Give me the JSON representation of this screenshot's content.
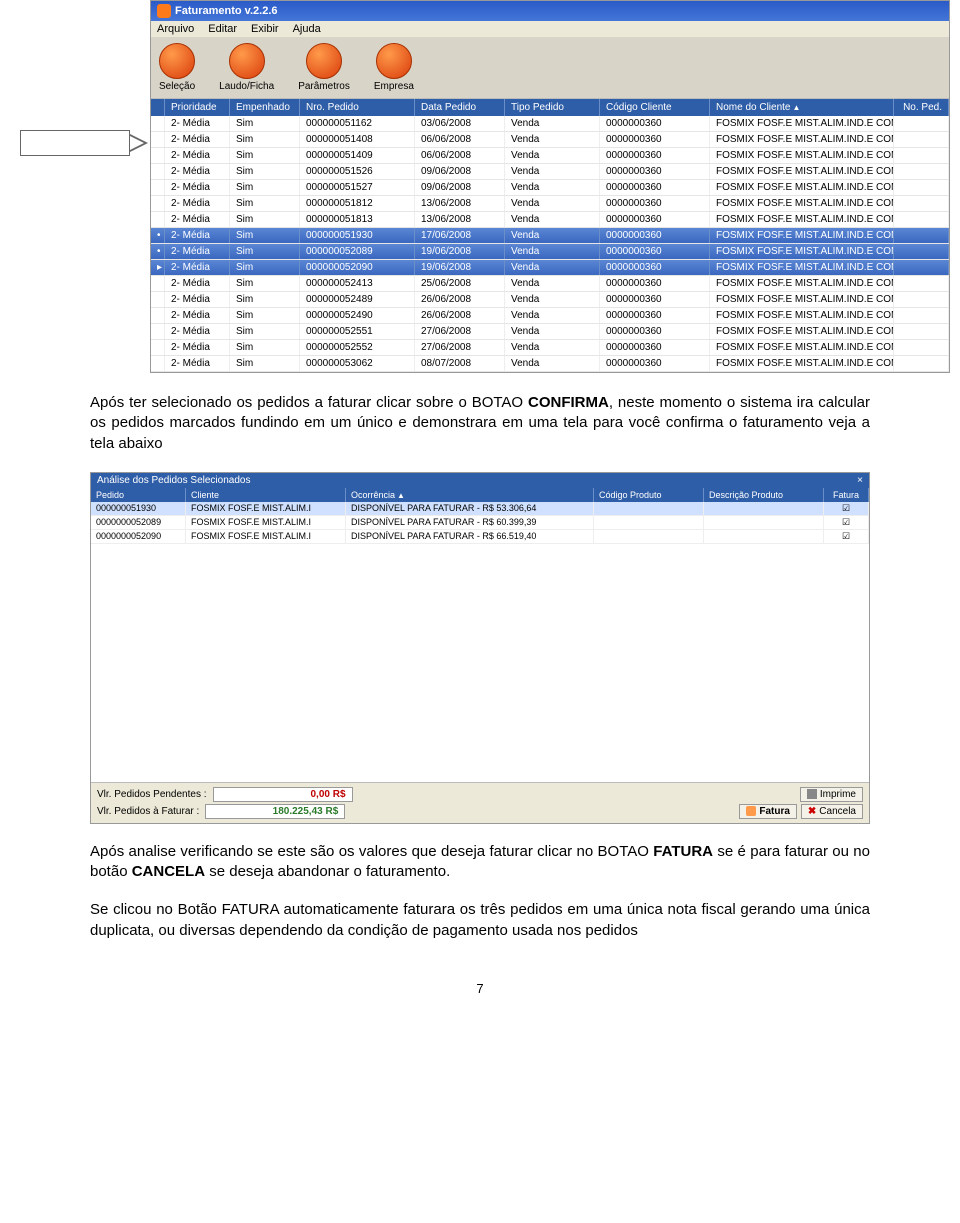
{
  "window": {
    "title": "Faturamento v.2.2.6",
    "menu": [
      "Arquivo",
      "Editar",
      "Exibir",
      "Ajuda"
    ],
    "toolbar": [
      {
        "label": "Seleção"
      },
      {
        "label": "Laudo/Ficha"
      },
      {
        "label": "Parâmetros"
      },
      {
        "label": "Empresa"
      }
    ]
  },
  "grid": {
    "headers": {
      "prioridade": "Prioridade",
      "empenhado": "Empenhado",
      "nro_pedido": "Nro. Pedido",
      "data_pedido": "Data Pedido",
      "tipo_pedido": "Tipo Pedido",
      "codigo_cliente": "Código Cliente",
      "nome_cliente": "Nome do Cliente",
      "no_ped": "No. Ped."
    },
    "rows": [
      {
        "mark": "",
        "prio": "2- Média",
        "emp": "Sim",
        "nro": "000000051162",
        "data": "03/06/2008",
        "tipo": "Venda",
        "cod": "0000000360",
        "nome": "FOSMIX FOSF.E MIST.ALIM.IND.E COM...",
        "sel": false
      },
      {
        "mark": "",
        "prio": "2- Média",
        "emp": "Sim",
        "nro": "000000051408",
        "data": "06/06/2008",
        "tipo": "Venda",
        "cod": "0000000360",
        "nome": "FOSMIX FOSF.E MIST.ALIM.IND.E COM...",
        "sel": false
      },
      {
        "mark": "",
        "prio": "2- Média",
        "emp": "Sim",
        "nro": "000000051409",
        "data": "06/06/2008",
        "tipo": "Venda",
        "cod": "0000000360",
        "nome": "FOSMIX FOSF.E MIST.ALIM.IND.E COM...",
        "sel": false
      },
      {
        "mark": "",
        "prio": "2- Média",
        "emp": "Sim",
        "nro": "000000051526",
        "data": "09/06/2008",
        "tipo": "Venda",
        "cod": "0000000360",
        "nome": "FOSMIX FOSF.E MIST.ALIM.IND.E COM...",
        "sel": false
      },
      {
        "mark": "",
        "prio": "2- Média",
        "emp": "Sim",
        "nro": "000000051527",
        "data": "09/06/2008",
        "tipo": "Venda",
        "cod": "0000000360",
        "nome": "FOSMIX FOSF.E MIST.ALIM.IND.E COM...",
        "sel": false
      },
      {
        "mark": "",
        "prio": "2- Média",
        "emp": "Sim",
        "nro": "000000051812",
        "data": "13/06/2008",
        "tipo": "Venda",
        "cod": "0000000360",
        "nome": "FOSMIX FOSF.E MIST.ALIM.IND.E COM...",
        "sel": false
      },
      {
        "mark": "",
        "prio": "2- Média",
        "emp": "Sim",
        "nro": "000000051813",
        "data": "13/06/2008",
        "tipo": "Venda",
        "cod": "0000000360",
        "nome": "FOSMIX FOSF.E MIST.ALIM.IND.E COM...",
        "sel": false
      },
      {
        "mark": "•",
        "prio": "2- Média",
        "emp": "Sim",
        "nro": "000000051930",
        "data": "17/06/2008",
        "tipo": "Venda",
        "cod": "0000000360",
        "nome": "FOSMIX FOSF.E MIST.ALIM.IND.E COM...",
        "sel": true
      },
      {
        "mark": "•",
        "prio": "2- Média",
        "emp": "Sim",
        "nro": "000000052089",
        "data": "19/06/2008",
        "tipo": "Venda",
        "cod": "0000000360",
        "nome": "FOSMIX FOSF.E MIST.ALIM.IND.E COM...",
        "sel": true
      },
      {
        "mark": "▸",
        "prio": "2- Média",
        "emp": "Sim",
        "nro": "000000052090",
        "data": "19/06/2008",
        "tipo": "Venda",
        "cod": "0000000360",
        "nome": "FOSMIX FOSF.E MIST.ALIM.IND.E COM...",
        "sel": true
      },
      {
        "mark": "",
        "prio": "2- Média",
        "emp": "Sim",
        "nro": "000000052413",
        "data": "25/06/2008",
        "tipo": "Venda",
        "cod": "0000000360",
        "nome": "FOSMIX FOSF.E MIST.ALIM.IND.E COM...",
        "sel": false
      },
      {
        "mark": "",
        "prio": "2- Média",
        "emp": "Sim",
        "nro": "000000052489",
        "data": "26/06/2008",
        "tipo": "Venda",
        "cod": "0000000360",
        "nome": "FOSMIX FOSF.E MIST.ALIM.IND.E COM...",
        "sel": false
      },
      {
        "mark": "",
        "prio": "2- Média",
        "emp": "Sim",
        "nro": "000000052490",
        "data": "26/06/2008",
        "tipo": "Venda",
        "cod": "0000000360",
        "nome": "FOSMIX FOSF.E MIST.ALIM.IND.E COM...",
        "sel": false
      },
      {
        "mark": "",
        "prio": "2- Média",
        "emp": "Sim",
        "nro": "000000052551",
        "data": "27/06/2008",
        "tipo": "Venda",
        "cod": "0000000360",
        "nome": "FOSMIX FOSF.E MIST.ALIM.IND.E COM...",
        "sel": false
      },
      {
        "mark": "",
        "prio": "2- Média",
        "emp": "Sim",
        "nro": "000000052552",
        "data": "27/06/2008",
        "tipo": "Venda",
        "cod": "0000000360",
        "nome": "FOSMIX FOSF.E MIST.ALIM.IND.E COM...",
        "sel": false
      },
      {
        "mark": "",
        "prio": "2- Média",
        "emp": "Sim",
        "nro": "000000053062",
        "data": "08/07/2008",
        "tipo": "Venda",
        "cod": "0000000360",
        "nome": "FOSMIX FOSF.E MIST.ALIM.IND.E COM...",
        "sel": false
      }
    ]
  },
  "para1": {
    "t1": "Após ter selecionado os pedidos a faturar clicar sobre o BOTAO ",
    "b1": "CONFIRMA",
    "t2": ", neste momento o sistema ira calcular os pedidos marcados fundindo em um único e demonstrara em uma tela para você confirma o faturamento veja a tela abaixo"
  },
  "panel2": {
    "title": "Análise dos Pedidos Selecionados",
    "close": "×",
    "headers": {
      "pedido": "Pedido",
      "cliente": "Cliente",
      "ocorrencia": "Ocorrência",
      "cod_produto": "Código Produto",
      "desc_produto": "Descrição Produto",
      "fatura": "Fatura"
    },
    "rows": [
      {
        "ped": "000000051930",
        "cli": "FOSMIX FOSF.E MIST.ALIM.I",
        "oco": "DISPONÍVEL PARA FATURAR - R$ 53.306,64",
        "cod": "",
        "desc": "",
        "fat": "☑",
        "hl": true
      },
      {
        "ped": "0000000052089",
        "cli": "FOSMIX FOSF.E MIST.ALIM.I",
        "oco": "DISPONÍVEL PARA FATURAR - R$ 60.399,39",
        "cod": "",
        "desc": "",
        "fat": "☑",
        "hl": false
      },
      {
        "ped": "0000000052090",
        "cli": "FOSMIX FOSF.E MIST.ALIM.I",
        "oco": "DISPONÍVEL PARA FATURAR - R$ 66.519,40",
        "cod": "",
        "desc": "",
        "fat": "☑",
        "hl": false
      }
    ],
    "footer": {
      "pend_label": "Vlr. Pedidos Pendentes :",
      "pend_value": "0,00 R$",
      "fat_label": "Vlr. Pedidos à Faturar :",
      "fat_value": "180.225,43 R$",
      "btn_fatura": "Fatura",
      "btn_imprime": "Imprime",
      "btn_cancela": "Cancela"
    }
  },
  "para2": {
    "t1": "Após analise verificando se este são os valores que deseja faturar clicar no BOTAO ",
    "b1": "FATURA",
    "t2": " se é para faturar ou no botão ",
    "b2": "CANCELA",
    "t3": " se deseja abandonar o faturamento.",
    "t4": "Se clicou no Botão FATURA automaticamente faturara os três pedidos em uma única nota fiscal gerando uma única duplicata, ou diversas dependendo da condição de pagamento usada nos pedidos"
  },
  "page_number": "7"
}
